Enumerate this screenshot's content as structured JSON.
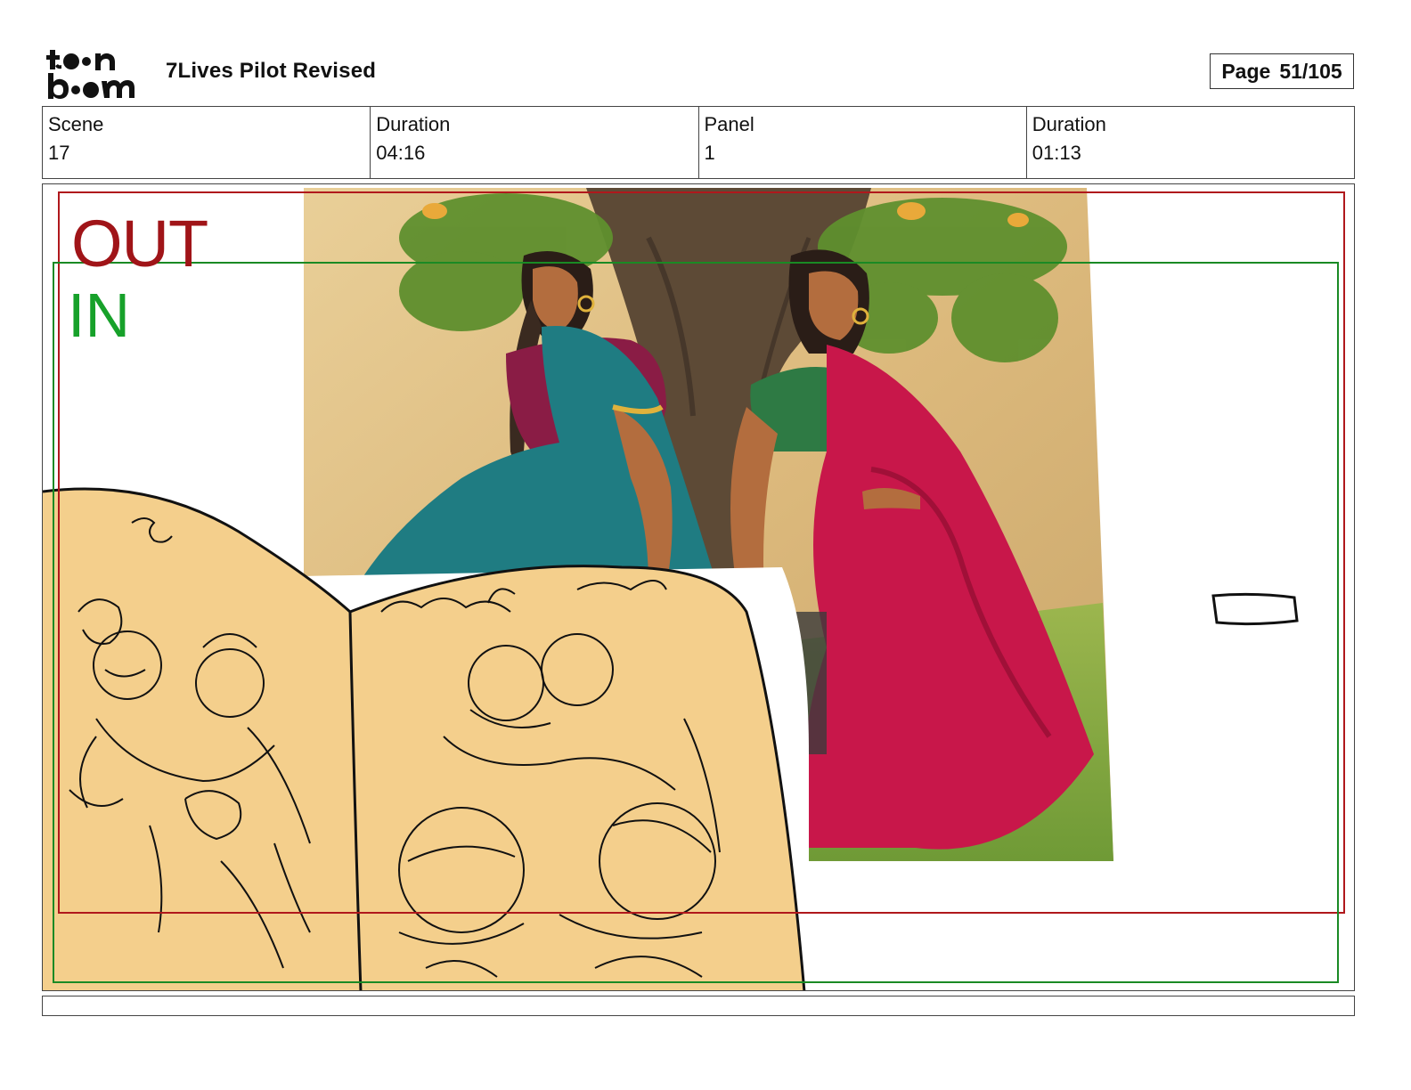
{
  "header": {
    "brand": "toon boom",
    "document_title": "7Lives Pilot Revised",
    "page_label": "Page",
    "page_value": "51/105"
  },
  "info": {
    "scene_label": "Scene",
    "scene_value": "17",
    "scene_duration_label": "Duration",
    "scene_duration_value": "04:16",
    "panel_label": "Panel",
    "panel_value": "1",
    "panel_duration_label": "Duration",
    "panel_duration_value": "01:13"
  },
  "panel": {
    "out_label": "OUT",
    "in_label": "IN",
    "out_frame_color": "#b0181c",
    "in_frame_color": "#1a8a24",
    "book_color": "#f4cf8c"
  },
  "caption": {
    "text": ""
  }
}
